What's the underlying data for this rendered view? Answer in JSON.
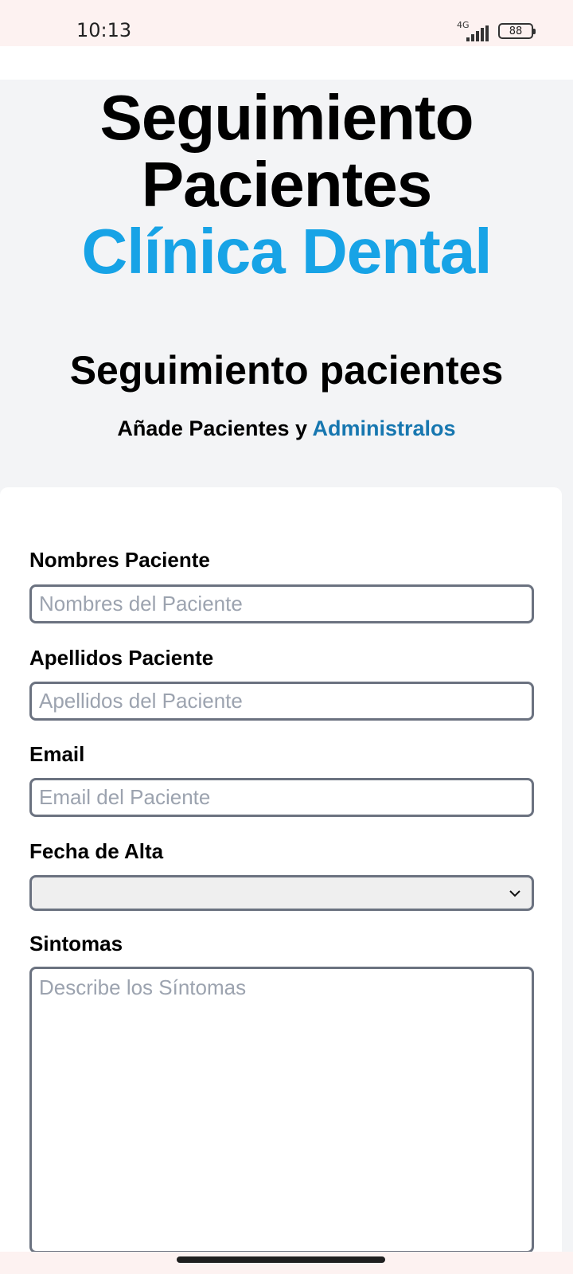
{
  "status_bar": {
    "time": "10:13",
    "network": "4G",
    "battery": "88",
    "icons": [
      "signal-icon",
      "battery-icon"
    ]
  },
  "header": {
    "title_lines": [
      "Seguimiento",
      "Pacientes"
    ],
    "title_accent": "Clínica Dental",
    "subtitle": "Seguimiento pacientes",
    "tagline_prefix": "Añade Pacientes y",
    "tagline_accent": "Administralos"
  },
  "form": {
    "fields": [
      {
        "label": "Nombres Paciente",
        "placeholder": "Nombres del Paciente",
        "value": ""
      },
      {
        "label": "Apellidos Paciente",
        "placeholder": "Apellidos del Paciente",
        "value": ""
      },
      {
        "label": "Email",
        "placeholder": "Email del Paciente",
        "value": ""
      },
      {
        "label": "Fecha de Alta",
        "value": ""
      },
      {
        "label": "Sintomas",
        "placeholder": "Describe los Síntomas",
        "value": ""
      }
    ]
  },
  "colors": {
    "accent_title": "#17a3e6",
    "accent_tagline": "#1777b0",
    "header_bg": "#f3f4f6",
    "input_border": "#6b7280"
  }
}
